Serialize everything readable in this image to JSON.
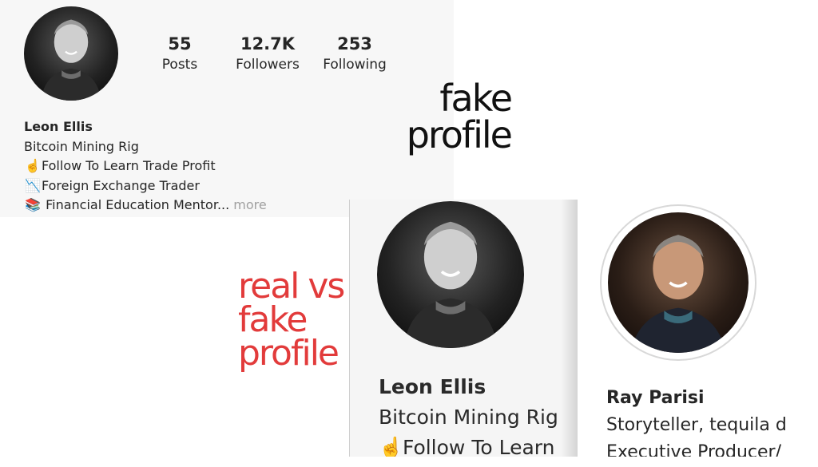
{
  "top_profile": {
    "stats": [
      {
        "value": "55",
        "label": "Posts"
      },
      {
        "value": "12.7K",
        "label": "Followers"
      },
      {
        "value": "253",
        "label": "Following"
      }
    ],
    "name": "Leon Ellis",
    "bio_lines": [
      {
        "emoji": "",
        "text": "Bitcoin Mining Rig"
      },
      {
        "emoji": "☝️",
        "text": "Follow To Learn Trade Profit"
      },
      {
        "emoji": "📉",
        "text": "Foreign Exchange Trader"
      },
      {
        "emoji": "📚",
        "text": "Financial Education Mentor..."
      }
    ],
    "more": "more"
  },
  "annotations": {
    "fake_profile": [
      "fake",
      "profile"
    ],
    "real_vs_fake": [
      "real vs",
      "fake",
      "profile"
    ],
    "fake_color": "#111111",
    "real_vs_fake_color": "#e23b3b"
  },
  "comparison_left": {
    "name": "Leon Ellis",
    "line1": "Bitcoin Mining Rig",
    "line2_emoji": "☝️",
    "line2": "Follow To Learn"
  },
  "comparison_right": {
    "name": "Ray Parisi",
    "line1": "Storyteller, tequila d",
    "line2": "Executive Producer/"
  },
  "icons": [
    "profile-photo-bw",
    "profile-photo-color"
  ]
}
